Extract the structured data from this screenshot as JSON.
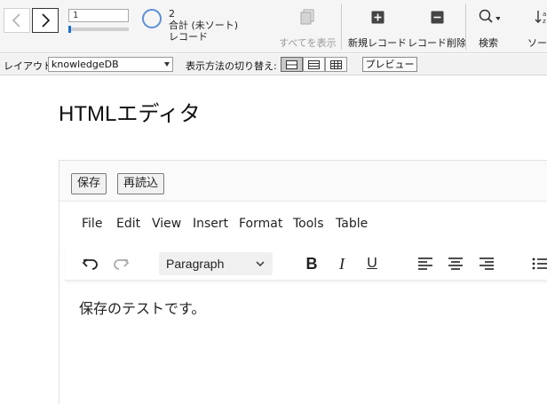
{
  "toolbar": {
    "record_number": "1",
    "found_count": "2",
    "total_label": "合計 (未ソート)",
    "unit_label": "レコード",
    "show_all_label": "すべてを表示",
    "new_record_label": "新規レコード",
    "delete_record_label": "レコード削除",
    "find_label": "検索",
    "sort_label": "ソート",
    "accent_color": "#1a6fd1"
  },
  "layoutbar": {
    "layout_label": "レイアウト:",
    "layout_value": "knowledgeDB",
    "view_switch_label": "表示方法の切り替え:",
    "preview_label": "プレビュー"
  },
  "page": {
    "title": "HTMLエディタ"
  },
  "panel": {
    "save_label": "保存",
    "reload_label": "再読込"
  },
  "editor": {
    "menus": [
      "File",
      "Edit",
      "View",
      "Insert",
      "Format",
      "Tools",
      "Table"
    ],
    "block_format": "Paragraph",
    "content": "保存のテストです。"
  }
}
